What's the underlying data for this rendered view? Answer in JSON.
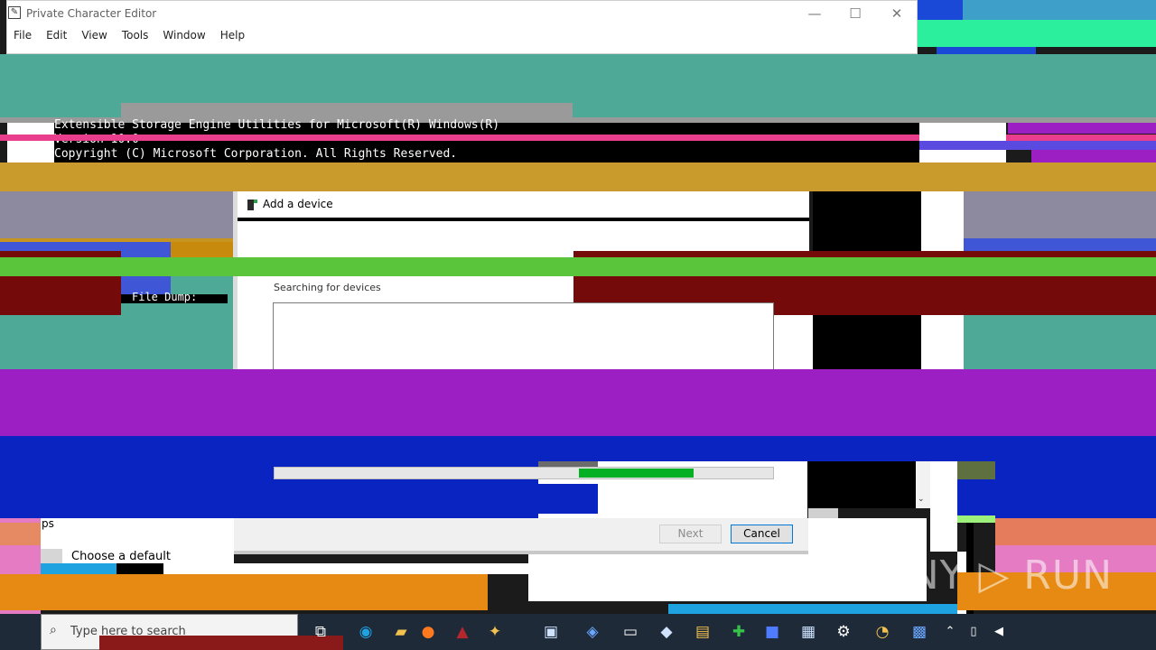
{
  "pce": {
    "title": "Private Character Editor",
    "menu": [
      "File",
      "Edit",
      "View",
      "Tools",
      "Window",
      "Help"
    ],
    "minimize": "—",
    "maximize": "☐",
    "close": "✕"
  },
  "console": {
    "line1": "Extensible Storage Engine Utilities for Microsoft(R) Windows(R)",
    "line2": "Version 10.0",
    "line3": "Copyright (C) Microsoft Corporation. All Rights Reserved.",
    "file_dump": "File Dump:"
  },
  "dialog": {
    "title": "Add a device",
    "searching": "Searching for devices",
    "progress": 0.27,
    "next": "Next",
    "cancel": "Cancel"
  },
  "background": {
    "apps_fragment": "ps",
    "choose_default": "Choose a default"
  },
  "taskbar": {
    "search_placeholder": "Type here to search"
  },
  "watermark": "ANY ▷ RUN",
  "colors": {
    "teal": "#4ea996",
    "magenta": "#9b1fc2",
    "blue": "#0a24c2",
    "green": "#5ac43a",
    "gold": "#c99a2c",
    "orange": "#e68a13",
    "maroon": "#740a0a"
  }
}
